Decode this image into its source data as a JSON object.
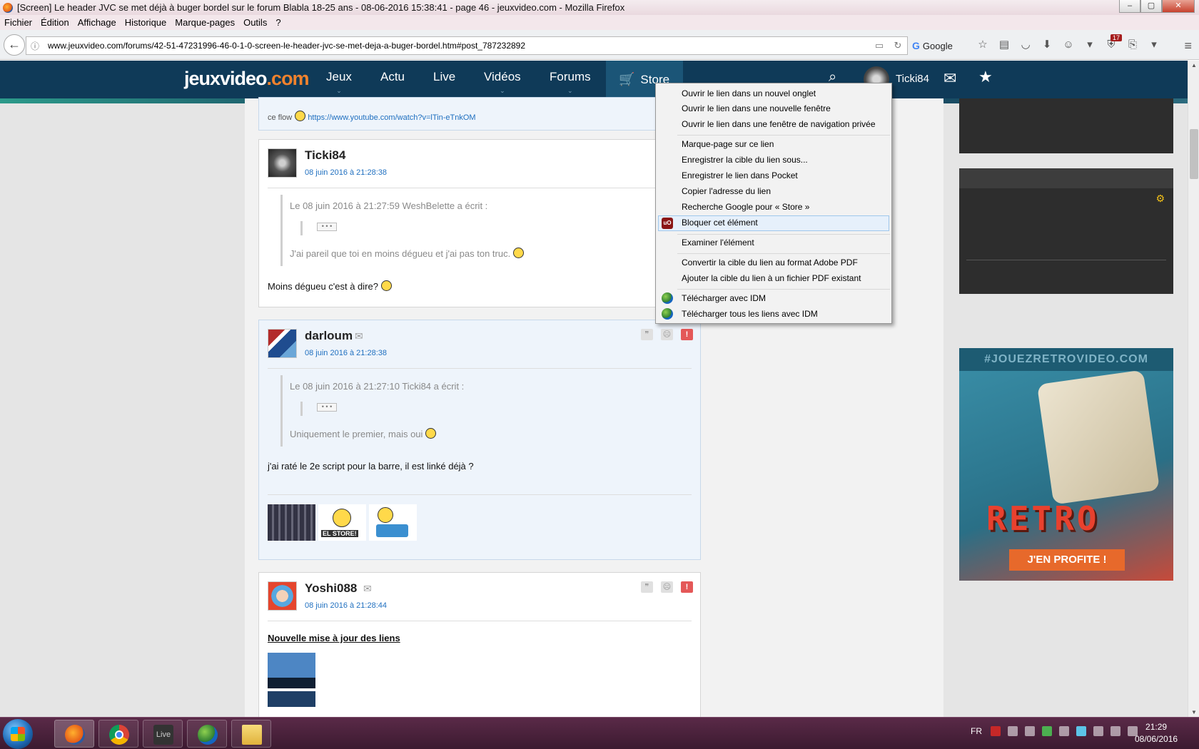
{
  "window": {
    "title": "[Screen] Le header JVC se met déjà à buger bordel sur le forum Blabla 18-25 ans - 08-06-2016 15:38:41 - page 46 - jeuxvideo.com - Mozilla Firefox",
    "controls": {
      "minimize": "‒",
      "maximize": "▢",
      "close": "✕"
    }
  },
  "menubar": [
    "Fichier",
    "Édition",
    "Affichage",
    "Historique",
    "Marque-pages",
    "Outils",
    "?"
  ],
  "toolbar": {
    "url": "www.jeuxvideo.com/forums/42-51-47231996-46-0-1-0-screen-le-header-jvc-se-met-deja-a-buger-bordel.htm#post_787232892",
    "search_engine": "Google",
    "ublock_count": "17"
  },
  "site": {
    "logo_main": "jeuxvideo",
    "logo_domain": ".com",
    "nav": [
      "Jeux",
      "Actu",
      "Live",
      "Vidéos",
      "Forums"
    ],
    "store_label": "Store",
    "username": "Ticki84"
  },
  "posts": {
    "top": {
      "text": "ce flow",
      "link": "https://www.youtube.com/watch?v=lTin-eTnkOM"
    },
    "p1": {
      "author": "Ticki84",
      "date": "08 juin 2016 à 21:28:38",
      "quote_header": "Le 08 juin 2016 à 21:27:59 WeshBelette a écrit :",
      "quote_dots": "• • •",
      "quote_text": "J'ai pareil que toi en moins dégueu et j'ai pas ton truc.",
      "body": "Moins dégueu c'est à dire?"
    },
    "p2": {
      "author": "darloum",
      "date": "08 juin 2016 à 21:28:38",
      "quote_header": "Le 08 juin 2016 à 21:27:10 Ticki84 a écrit :",
      "quote_dots": "• • •",
      "quote_text": "Uniquement le premier, mais oui",
      "body": "j'ai raté le 2e script pour la barre, il est linké déjà ?",
      "sig_label": "EL STORE!"
    },
    "p3": {
      "author": "Yoshi088",
      "date": "08 juin 2016 à 21:28:44",
      "body": "Nouvelle mise à jour des liens"
    }
  },
  "promo": {
    "tag": "#JOUEZRETROVIDEO.COM",
    "title": "RETRO",
    "cta": "J'EN PROFITE !"
  },
  "context_menu": {
    "items": [
      "Ouvrir le lien dans un nouvel onglet",
      "Ouvrir le lien dans une nouvelle fenêtre",
      "Ouvrir le lien dans une fenêtre de navigation privée",
      "Marque-page sur ce lien",
      "Enregistrer la cible du lien sous...",
      "Enregistrer le lien dans Pocket",
      "Copier l'adresse du lien",
      "Recherche Google pour « Store »",
      "Bloquer cet élément",
      "Examiner l'élément",
      "Convertir la cible du lien au format Adobe PDF",
      "Ajouter la cible du lien à un fichier PDF existant",
      "Télécharger avec IDM",
      "Télécharger tous les liens avec IDM"
    ],
    "highlighted": "Bloquer cet élément"
  },
  "taskbar": {
    "live_label": "Live",
    "lang": "FR",
    "time": "21:29",
    "date": "08/06/2016"
  }
}
